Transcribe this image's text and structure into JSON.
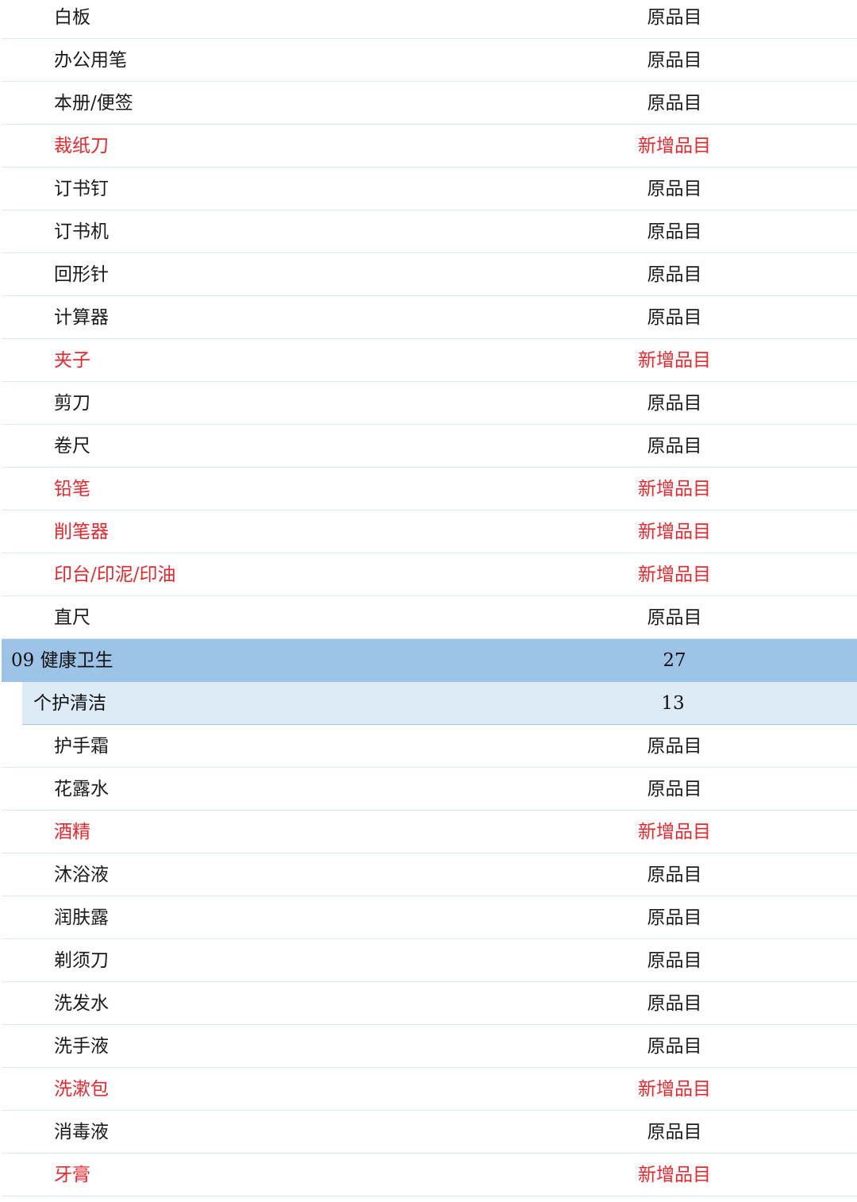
{
  "rows": [
    {
      "type": "item",
      "name": "白板",
      "status": "原品目",
      "new": false
    },
    {
      "type": "item",
      "name": "办公用笔",
      "status": "原品目",
      "new": false
    },
    {
      "type": "item",
      "name": "本册/便签",
      "status": "原品目",
      "new": false
    },
    {
      "type": "item",
      "name": "裁纸刀",
      "status": "新增品目",
      "new": true
    },
    {
      "type": "item",
      "name": "订书钉",
      "status": "原品目",
      "new": false
    },
    {
      "type": "item",
      "name": "订书机",
      "status": "原品目",
      "new": false
    },
    {
      "type": "item",
      "name": "回形针",
      "status": "原品目",
      "new": false
    },
    {
      "type": "item",
      "name": "计算器",
      "status": "原品目",
      "new": false
    },
    {
      "type": "item",
      "name": "夹子",
      "status": "新增品目",
      "new": true
    },
    {
      "type": "item",
      "name": "剪刀",
      "status": "原品目",
      "new": false
    },
    {
      "type": "item",
      "name": "卷尺",
      "status": "原品目",
      "new": false
    },
    {
      "type": "item",
      "name": "铅笔",
      "status": "新增品目",
      "new": true
    },
    {
      "type": "item",
      "name": "削笔器",
      "status": "新增品目",
      "new": true
    },
    {
      "type": "item",
      "name": "印台/印泥/印油",
      "status": "新增品目",
      "new": true
    },
    {
      "type": "item",
      "name": "直尺",
      "status": "原品目",
      "new": false
    },
    {
      "type": "category",
      "name": "09 健康卫生",
      "status": "27",
      "new": false
    },
    {
      "type": "subcategory",
      "name": "个护清洁",
      "status": "13",
      "new": false
    },
    {
      "type": "item",
      "name": "护手霜",
      "status": "原品目",
      "new": false
    },
    {
      "type": "item",
      "name": "花露水",
      "status": "原品目",
      "new": false
    },
    {
      "type": "item",
      "name": "酒精",
      "status": "新增品目",
      "new": true
    },
    {
      "type": "item",
      "name": "沐浴液",
      "status": "原品目",
      "new": false
    },
    {
      "type": "item",
      "name": "润肤露",
      "status": "原品目",
      "new": false
    },
    {
      "type": "item",
      "name": "剃须刀",
      "status": "原品目",
      "new": false
    },
    {
      "type": "item",
      "name": "洗发水",
      "status": "原品目",
      "new": false
    },
    {
      "type": "item",
      "name": "洗手液",
      "status": "原品目",
      "new": false
    },
    {
      "type": "item",
      "name": "洗漱包",
      "status": "新增品目",
      "new": true
    },
    {
      "type": "item",
      "name": "消毒液",
      "status": "原品目",
      "new": false
    },
    {
      "type": "item",
      "name": "牙膏",
      "status": "新增品目",
      "new": true
    }
  ],
  "colors": {
    "new_item_text": "#e8262b",
    "category_background": "#9dc3e6",
    "subcategory_background": "#ddebf7",
    "row_divider": "#dce8f4"
  }
}
